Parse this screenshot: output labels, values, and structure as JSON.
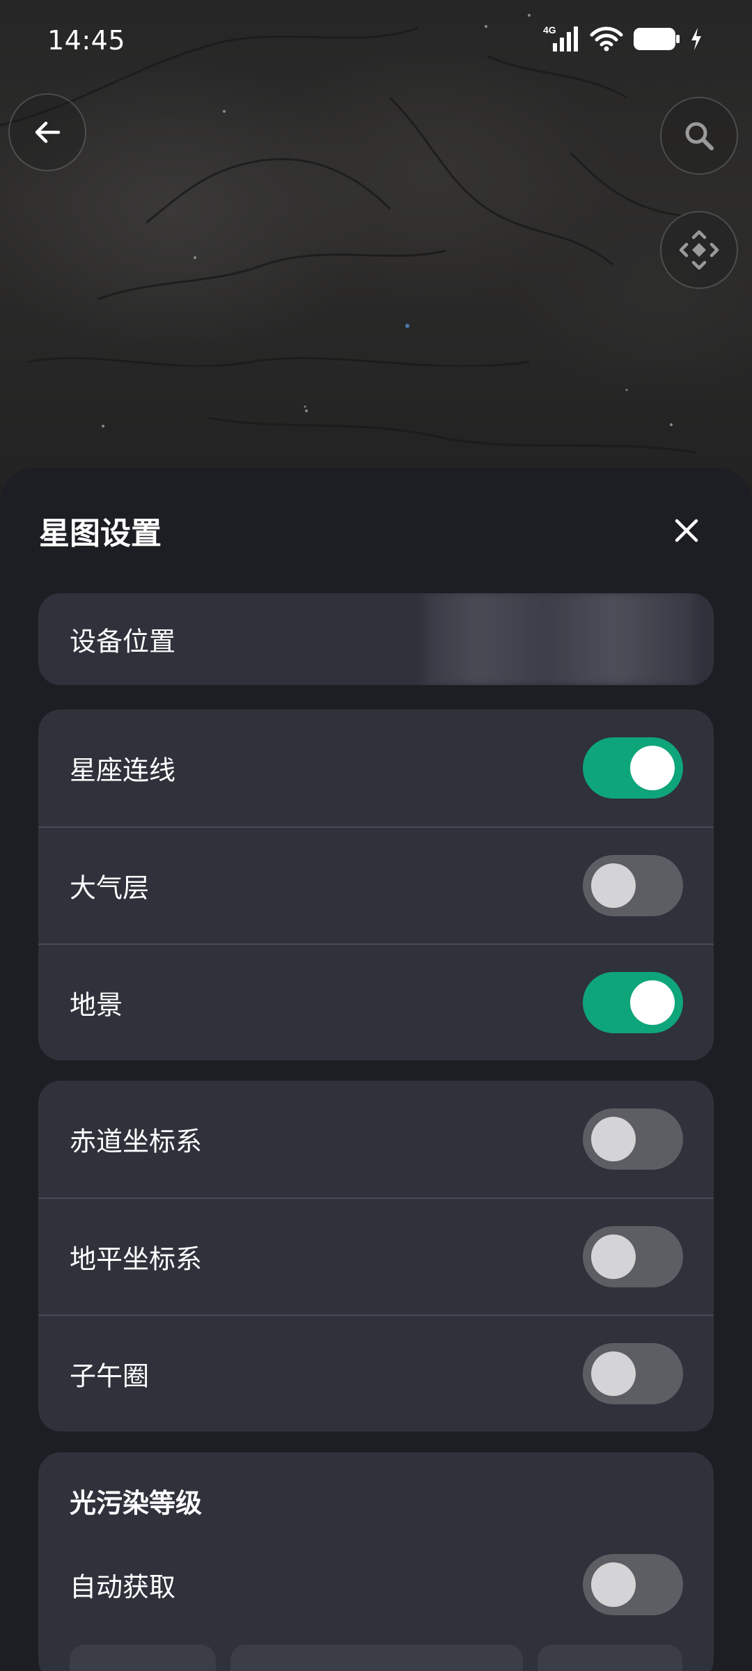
{
  "status_bar": {
    "time": "14:45",
    "network": "4G",
    "icons": [
      "signal-icon",
      "wifi-icon",
      "battery-icon",
      "charging-icon"
    ]
  },
  "top_buttons": {
    "back_icon": "arrow-left-icon",
    "search_icon": "search-icon",
    "locate_icon": "locate-icon"
  },
  "sheet": {
    "title": "星图设置",
    "close_icon": "close-icon",
    "location": {
      "label": "设备位置",
      "value": ""
    },
    "display_group": [
      {
        "label": "星座连线",
        "on": true
      },
      {
        "label": "大气层",
        "on": false
      },
      {
        "label": "地景",
        "on": true
      }
    ],
    "coordinate_group": [
      {
        "label": "赤道坐标系",
        "on": false
      },
      {
        "label": "地平坐标系",
        "on": false
      },
      {
        "label": "子午圈",
        "on": false
      }
    ],
    "light_pollution": {
      "title": "光污染等级",
      "auto_label": "自动获取",
      "auto_on": false
    }
  },
  "colors": {
    "sheet_background": "#1d1e23",
    "card_background": "#2f313b",
    "toggle_on": "#0ea57a",
    "toggle_off": "#5d5e64"
  }
}
